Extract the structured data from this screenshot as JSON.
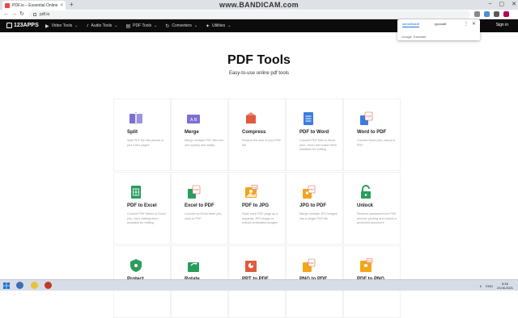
{
  "browser": {
    "tab_title": "PDF.io – Essential Online PDF Tools",
    "tab_close": "×",
    "new_tab": "+",
    "url": "pdf.io",
    "watermark": "www.BANDICAM.com",
    "win_min": "–",
    "win_max": "▢",
    "win_close": "✕",
    "back": "←",
    "forward": "→",
    "reload": "↻"
  },
  "app_nav": {
    "logo": "123APPS",
    "items": [
      {
        "label": "Video Tools",
        "icon": "▶"
      },
      {
        "label": "Audio Tools",
        "icon": "♪"
      },
      {
        "label": "PDF Tools",
        "icon": "▤"
      },
      {
        "label": "Converters",
        "icon": "↻"
      },
      {
        "label": "Utilities",
        "icon": "✦"
      }
    ],
    "chevron": "⌄",
    "signin": "Sign in"
  },
  "translate_popup": {
    "tab_source": "английский",
    "tab_target": "русский",
    "more": "⋮",
    "close": "✕",
    "footer": "Google Translate"
  },
  "page": {
    "title": "PDF Tools",
    "subtitle": "Easy-to-use online pdf tools"
  },
  "tools": [
    {
      "name": "Split",
      "desc": "Split PDF file into pieces or just a few pages",
      "icon": "split-icon",
      "color": "#7c6fd6"
    },
    {
      "name": "Merge",
      "desc": "Merge multiple PDF files into one quickly and easily",
      "icon": "merge-icon",
      "color": "#7c6fd6"
    },
    {
      "name": "Compress",
      "desc": "Reduce the size of your PDF file",
      "icon": "compress-icon",
      "color": "#e05a3c"
    },
    {
      "name": "PDF to Word",
      "desc": "Convert PDF files to Word (doc, docx) and make them available for editing",
      "icon": "word-icon",
      "color": "#3d7be0"
    },
    {
      "name": "Word to PDF",
      "desc": "Convert Word (doc, docx) to PDF",
      "icon": "word-to-pdf-icon",
      "color": "#3d7be0"
    },
    {
      "name": "PDF to Excel",
      "desc": "Convert PDF tables to Excel (xls, xlsx) making them available for editing",
      "icon": "excel-icon",
      "color": "#2a9d5c"
    },
    {
      "name": "Excel to PDF",
      "desc": "Convert an Excel table (xls, xlsx) to PDF",
      "icon": "excel-to-pdf-icon",
      "color": "#2a9d5c"
    },
    {
      "name": "PDF to JPG",
      "desc": "Save each PDF page as a separate JPG image or extract embedded images",
      "icon": "pdf-to-jpg-icon",
      "color": "#f4a51c"
    },
    {
      "name": "JPG to PDF",
      "desc": "Merge multiple JPG images into a single PDF file",
      "icon": "jpg-to-pdf-icon",
      "color": "#f4a51c"
    },
    {
      "name": "Unlock",
      "desc": "Remove password from PDF, remove printing and unlock a protected document",
      "icon": "unlock-icon",
      "color": "#2a9d5c"
    },
    {
      "name": "Protect",
      "desc": "",
      "icon": "protect-icon",
      "color": "#2a9d5c"
    },
    {
      "name": "Rotate",
      "desc": "",
      "icon": "rotate-icon",
      "color": "#2a9d5c"
    },
    {
      "name": "PPT to PDF",
      "desc": "",
      "icon": "ppt-to-pdf-icon",
      "color": "#e05a3c"
    },
    {
      "name": "PNG to PDF",
      "desc": "",
      "icon": "png-to-pdf-icon",
      "color": "#f4a51c"
    },
    {
      "name": "PDF to PNG",
      "desc": "",
      "icon": "pdf-to-png-icon",
      "color": "#f4a51c"
    }
  ],
  "taskbar": {
    "lang": "ENG",
    "time": "8:46",
    "date": "23.06.2021",
    "tray_up": "∧"
  }
}
